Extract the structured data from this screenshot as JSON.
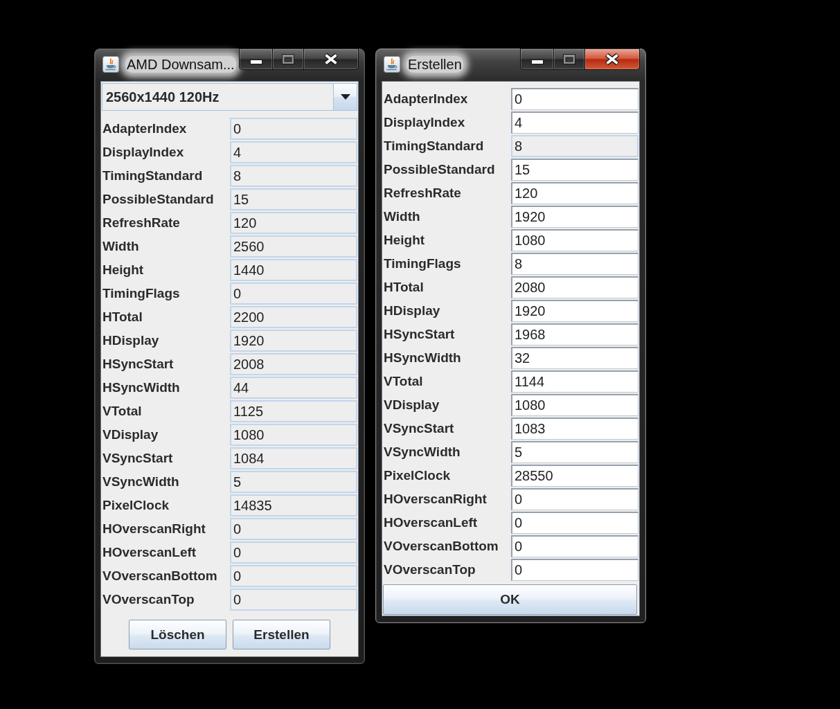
{
  "windows": [
    {
      "title": "AMD Downsam...",
      "active": false,
      "maximize_enabled": false,
      "dropdown": {
        "value": "2560x1440 120Hz"
      },
      "fields": [
        {
          "label": "AdapterIndex",
          "value": "0",
          "editable": false
        },
        {
          "label": "DisplayIndex",
          "value": "4",
          "editable": false
        },
        {
          "label": "TimingStandard",
          "value": "8",
          "editable": false
        },
        {
          "label": "PossibleStandard",
          "value": "15",
          "editable": false
        },
        {
          "label": "RefreshRate",
          "value": "120",
          "editable": false
        },
        {
          "label": "Width",
          "value": "2560",
          "editable": false
        },
        {
          "label": "Height",
          "value": "1440",
          "editable": false
        },
        {
          "label": "TimingFlags",
          "value": "0",
          "editable": false
        },
        {
          "label": "HTotal",
          "value": "2200",
          "editable": false
        },
        {
          "label": "HDisplay",
          "value": "1920",
          "editable": false
        },
        {
          "label": "HSyncStart",
          "value": "2008",
          "editable": false
        },
        {
          "label": "HSyncWidth",
          "value": "44",
          "editable": false
        },
        {
          "label": "VTotal",
          "value": "1125",
          "editable": false
        },
        {
          "label": "VDisplay",
          "value": "1080",
          "editable": false
        },
        {
          "label": "VSyncStart",
          "value": "1084",
          "editable": false
        },
        {
          "label": "VSyncWidth",
          "value": "5",
          "editable": false
        },
        {
          "label": "PixelClock",
          "value": "14835",
          "editable": false
        },
        {
          "label": "HOverscanRight",
          "value": "0",
          "editable": false
        },
        {
          "label": "HOverscanLeft",
          "value": "0",
          "editable": false
        },
        {
          "label": "VOverscanBottom",
          "value": "0",
          "editable": false
        },
        {
          "label": "VOverscanTop",
          "value": "0",
          "editable": false
        }
      ],
      "buttons": [
        "Löschen",
        "Erstellen"
      ]
    },
    {
      "title": "Erstellen",
      "active": true,
      "maximize_enabled": false,
      "fields": [
        {
          "label": "AdapterIndex",
          "value": "0",
          "editable": true
        },
        {
          "label": "DisplayIndex",
          "value": "4",
          "editable": true
        },
        {
          "label": "TimingStandard",
          "value": "8",
          "editable": false
        },
        {
          "label": "PossibleStandard",
          "value": "15",
          "editable": true
        },
        {
          "label": "RefreshRate",
          "value": "120",
          "editable": true
        },
        {
          "label": "Width",
          "value": "1920",
          "editable": true
        },
        {
          "label": "Height",
          "value": "1080",
          "editable": true
        },
        {
          "label": "TimingFlags",
          "value": "8",
          "editable": true
        },
        {
          "label": "HTotal",
          "value": "2080",
          "editable": true
        },
        {
          "label": "HDisplay",
          "value": "1920",
          "editable": true
        },
        {
          "label": "HSyncStart",
          "value": "1968",
          "editable": true
        },
        {
          "label": "HSyncWidth",
          "value": "32",
          "editable": true
        },
        {
          "label": "VTotal",
          "value": "1144",
          "editable": true
        },
        {
          "label": "VDisplay",
          "value": "1080",
          "editable": true
        },
        {
          "label": "VSyncStart",
          "value": "1083",
          "editable": true
        },
        {
          "label": "VSyncWidth",
          "value": "5",
          "editable": true
        },
        {
          "label": "PixelClock",
          "value": "28550",
          "editable": true
        },
        {
          "label": "HOverscanRight",
          "value": "0",
          "editable": true
        },
        {
          "label": "HOverscanLeft",
          "value": "0",
          "editable": true
        },
        {
          "label": "VOverscanBottom",
          "value": "0",
          "editable": true
        },
        {
          "label": "VOverscanTop",
          "value": "0",
          "editable": true
        }
      ],
      "buttons": [
        "OK"
      ]
    }
  ]
}
